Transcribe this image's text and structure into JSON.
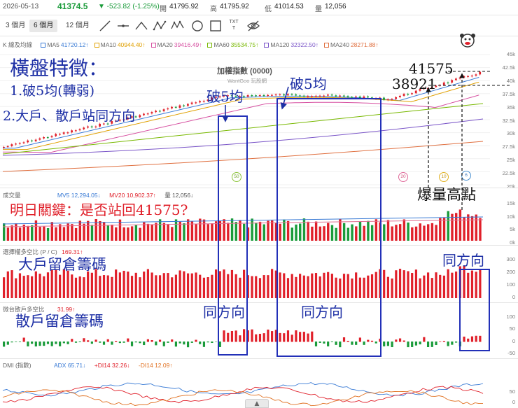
{
  "topbar": {
    "date": "2026-05-13",
    "price": "41374.5",
    "change": "▼ -523.82 (-1.25%)",
    "open_label": "開",
    "open": "41795.92",
    "high_label": "高",
    "high": "41795.92",
    "low_label": "低",
    "low": "41014.53",
    "vol_label": "量",
    "vol": "12,056",
    "colors": {
      "down": "#1a9b3a",
      "label": "#666666"
    }
  },
  "toolbar": {
    "tabs": [
      "3 個月",
      "6 個月",
      "12 個月"
    ],
    "active_tab": "6 個月",
    "tools": [
      "line-tool-icon",
      "hline-tool-icon",
      "polyline-tool-icon",
      "abcd-pattern-icon",
      "xabcd-pattern-icon",
      "circle-tool-icon",
      "rect-tool-icon",
      "text-tool-icon",
      "hide-drawings-icon"
    ],
    "text_tool_glyph": "TXT"
  },
  "kline_panel": {
    "header": "K 線及均線",
    "ma": [
      {
        "label": "MA5",
        "value": "41720.12↑",
        "color": "#3a7bd5"
      },
      {
        "label": "MA10",
        "value": "40944.40↑",
        "color": "#e0a000"
      },
      {
        "label": "MA20",
        "value": "39416.49↑",
        "color": "#d64fa0"
      },
      {
        "label": "MA60",
        "value": "35534.75↑",
        "color": "#78b800"
      },
      {
        "label": "MA120",
        "value": "32322.50↑",
        "color": "#7a55c8"
      },
      {
        "label": "MA240",
        "value": "28271.88↑",
        "color": "#e07040"
      }
    ],
    "axis": [
      "45k",
      "42.5k",
      "40k",
      "37.5k",
      "35k",
      "32.5k",
      "30k",
      "27.5k",
      "25k",
      "22.5k",
      "20k"
    ],
    "chart_title": "加權指數 (0000)",
    "watermark": "WantGoo 玩股網",
    "event_bubbles": [
      "50",
      "20",
      "10",
      "6"
    ]
  },
  "volume_panel": {
    "header": "成交量",
    "mv5": "MV5 12,294.05↓",
    "mv20": "MV20 10,902.37↑",
    "vol": "量 12,056↓",
    "axis": [
      "15k",
      "10k",
      "5k",
      "0k"
    ],
    "colors": {
      "mv5": "#3a7bd5",
      "mv20": "#e0202a"
    }
  },
  "options_panel": {
    "header": "選擇權多空比 (P / C)",
    "value": "169.31↑",
    "axis": [
      "300",
      "200",
      "100",
      "0"
    ]
  },
  "retail_panel": {
    "header": "微台散戶多空比",
    "value": "31.99↑",
    "axis": [
      "100",
      "50",
      "0",
      "-50"
    ]
  },
  "dmi_panel": {
    "header": "DMI (指數)",
    "adx": "ADX 65.71↓",
    "pdi": "+DI14 32.26↓",
    "mdi": "-DI14 12.09↑",
    "axis": [
      "50",
      "0"
    ],
    "colors": {
      "adx": "#3a7bd5",
      "pdi": "#e0202a",
      "mdi": "#e07020"
    }
  },
  "annotations": {
    "title": "橫盤特徵：",
    "point1": "1.破5均(轉弱)",
    "point2": "2.大戶、散戶站同方向",
    "break5_a": "破5均",
    "break5_b": "破5均",
    "level_high": "41575",
    "level_low": "38921",
    "volume_high": "爆量高點",
    "key_question": "明日關鍵：是否站回41575?",
    "big_holders": "大戶留倉籌碼",
    "same_dir_a": "同方向",
    "retail_holders": "散戶留倉籌碼",
    "same_dir_b": "同方向",
    "same_dir_c": "同方向"
  },
  "scroll_icon": "▲"
}
